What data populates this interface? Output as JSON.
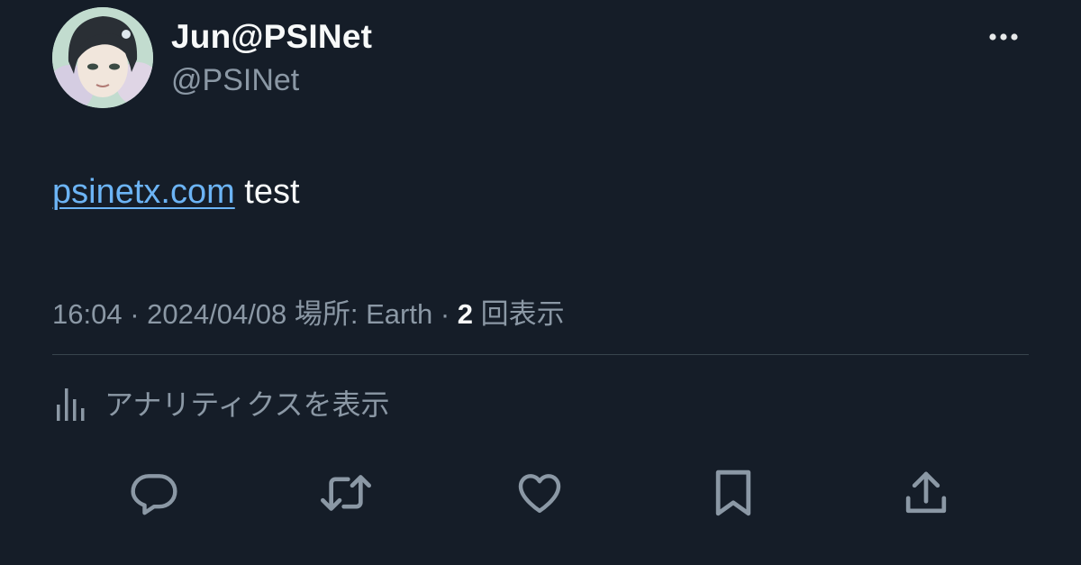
{
  "user": {
    "display_name": "Jun@PSINet",
    "handle": "@PSINet"
  },
  "tweet": {
    "link_text": "psinetx.com",
    "text_after_link": " test"
  },
  "meta": {
    "time": "16:04",
    "separator1": " · ",
    "date": "2024/04/08",
    "location_label": " 場所: Earth",
    "separator2": " · ",
    "views_count": "2",
    "views_label": " 回表示"
  },
  "analytics": {
    "label": "アナリティクスを表示",
    "icon": "bar-chart-icon"
  },
  "actions": [
    {
      "icon": "reply-icon"
    },
    {
      "icon": "retweet-icon"
    },
    {
      "icon": "like-icon"
    },
    {
      "icon": "bookmark-icon"
    },
    {
      "icon": "share-icon"
    }
  ],
  "colors": {
    "background": "#151d28",
    "primary_text": "#f7f9f9",
    "secondary_text": "#8b98a5",
    "link": "#6cb4f5",
    "divider": "#38444d"
  }
}
